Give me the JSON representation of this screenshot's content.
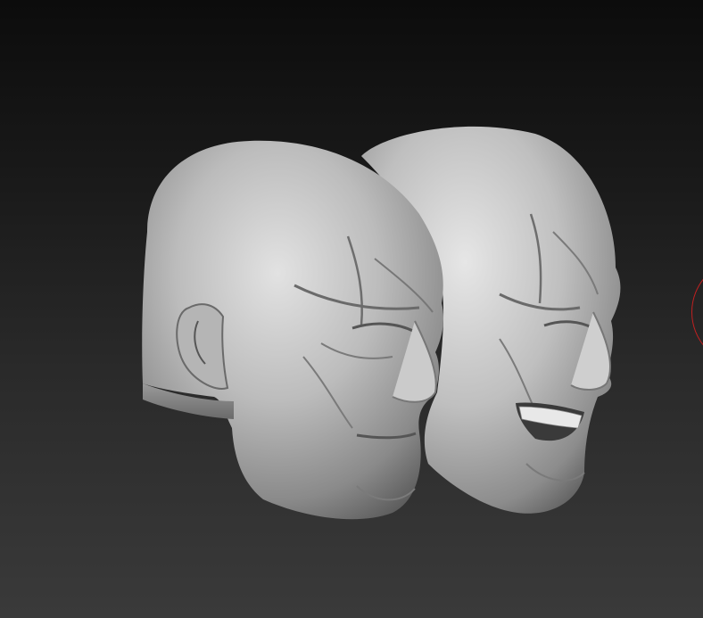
{
  "canvas": {
    "background_top": "#0c0c0c",
    "background_bottom": "#3a3a3a"
  },
  "models": [
    {
      "name": "neutral-head",
      "expression": "neutral",
      "material_color": "#bdbdbd"
    },
    {
      "name": "grinning-head",
      "expression": "grin",
      "material_color": "#c4c4c4"
    }
  ],
  "cursor": {
    "type": "brush-circle",
    "color": "#c02020"
  }
}
